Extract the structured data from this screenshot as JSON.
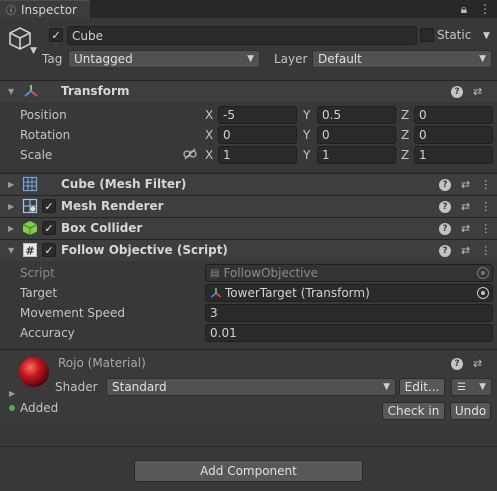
{
  "tab": {
    "label": "Inspector"
  },
  "object": {
    "name": "Cube",
    "active": true,
    "static_label": "Static",
    "static": false,
    "tag_label": "Tag",
    "tag_value": "Untagged",
    "layer_label": "Layer",
    "layer_value": "Default"
  },
  "transform": {
    "title": "Transform",
    "rows": [
      {
        "label": "Position",
        "x": "-5",
        "y": "0.5",
        "z": "0"
      },
      {
        "label": "Rotation",
        "x": "0",
        "y": "0",
        "z": "0"
      },
      {
        "label": "Scale",
        "x": "1",
        "y": "1",
        "z": "1"
      }
    ],
    "axes": {
      "x": "X",
      "y": "Y",
      "z": "Z"
    }
  },
  "components": {
    "mesh_filter": {
      "title": "Cube (Mesh Filter)"
    },
    "mesh_renderer": {
      "title": "Mesh Renderer",
      "enabled": true
    },
    "box_collider": {
      "title": "Box Collider",
      "enabled": true
    },
    "follow_objective": {
      "title": "Follow Objective (Script)",
      "enabled": true,
      "script_label": "Script",
      "script_value": "FollowObjective",
      "target_label": "Target",
      "target_value": "TowerTarget (Transform)",
      "speed_label": "Movement Speed",
      "speed_value": "3",
      "accuracy_label": "Accuracy",
      "accuracy_value": "0.01"
    }
  },
  "material": {
    "title": "Rojo (Material)",
    "color": "#b5121b",
    "shader_label": "Shader",
    "shader_value": "Standard",
    "edit_label": "Edit...",
    "added_label": "Added",
    "checkin_label": "Check in",
    "undo_label": "Undo"
  },
  "add_component_label": "Add Component",
  "colors": {
    "background": "#383838",
    "header": "#3e3e3e",
    "field": "#2a2a2a",
    "added_dot": "#4caf50"
  }
}
